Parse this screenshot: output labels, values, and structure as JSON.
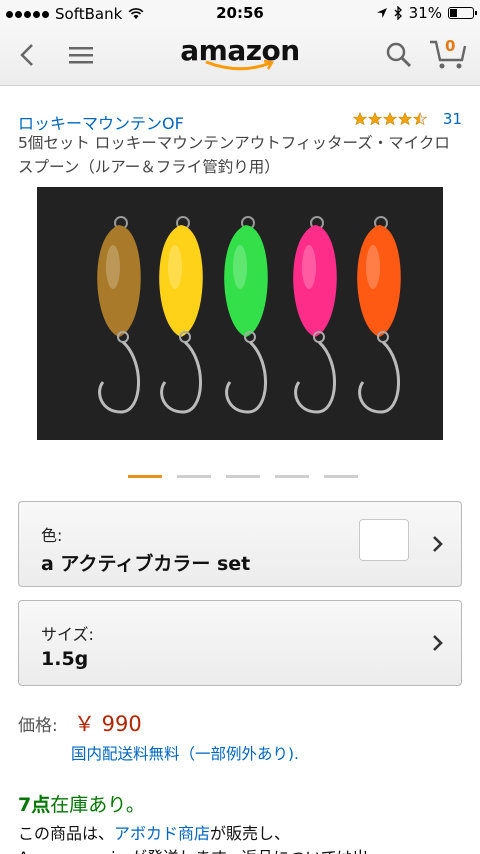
{
  "status_bar": {
    "carrier": "SoftBank",
    "time": "20:56",
    "battery": "31%",
    "battery_level": 0.31
  },
  "nav": {
    "logo": "amazon",
    "cart_count": "0"
  },
  "product": {
    "brand": "ロッキーマウンテンOF",
    "rating_stars": 4.5,
    "rating_count": "31",
    "title": "5個セット ロッキーマウンテンアウトフィッターズ・マイクロスプーン（ルアー＆フライ管釣り用）",
    "image_count": 5,
    "active_image": 0,
    "lure_colors": [
      "#a87a2a",
      "#ffd21a",
      "#33e04a",
      "#ff2d8a",
      "#ff5a14"
    ]
  },
  "options": {
    "color_label": "色:",
    "color_value": "a アクティブカラー set",
    "size_label": "サイズ:",
    "size_value": "1.5g"
  },
  "price": {
    "label": "価格:",
    "value": "￥ 990",
    "shipping": "国内配送料無料（一部例外あり)."
  },
  "stock": {
    "count": "7点",
    "text": "在庫あり。"
  },
  "seller": {
    "prefix": "この商品は、",
    "name": "アボカド商店",
    "suffix": "が販売し、",
    "line2": "Amazon.co.jp が発送します。返品については出"
  }
}
